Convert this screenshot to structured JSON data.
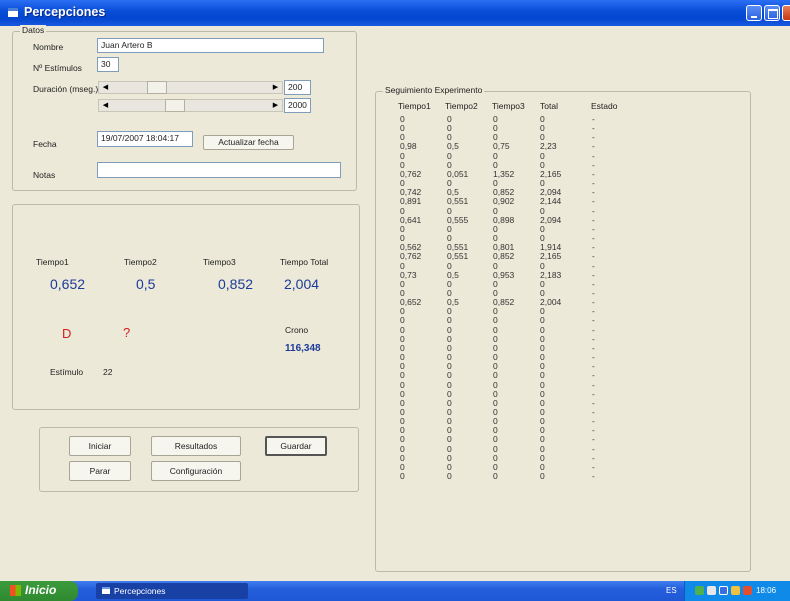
{
  "window": {
    "title": "Percepciones"
  },
  "datos": {
    "group_label": "Datos",
    "nombre_label": "Nombre",
    "nombre_value": "Juan Artero B",
    "estimulos_label": "Nº Estímulos",
    "estimulos_value": "30",
    "duracion_label": "Duración (mseg.)",
    "duracion1_value": "200",
    "duracion2_value": "2000",
    "fecha_label": "Fecha",
    "fecha_value": "19/07/2007 18:04:17",
    "actualizar_button": "Actualizar fecha",
    "notas_label": "Notas",
    "notas_value": ""
  },
  "results": {
    "tiempo1_label": "Tiempo1",
    "tiempo2_label": "Tiempo2",
    "tiempo3_label": "Tiempo3",
    "total_label": "Tiempo Total",
    "tiempo1_value": "0,652",
    "tiempo2_value": "0,5",
    "tiempo3_value": "0,852",
    "total_value": "2,004",
    "response1": "D",
    "response2": "?",
    "crono_label": "Crono",
    "crono_value": "116,348",
    "estimulo_label": "Estímulo",
    "estimulo_value": "22"
  },
  "buttons": {
    "iniciar": "Iniciar",
    "resultados": "Resultados",
    "guardar": "Guardar",
    "parar": "Parar",
    "configuracion": "Configuración"
  },
  "experiment": {
    "group_label": "Seguimiento Experimento",
    "headers": [
      "Tiempo1",
      "Tiempo2",
      "Tiempo3",
      "Total",
      "Estado"
    ],
    "rows": [
      [
        "0",
        "0",
        "0",
        "0",
        "-"
      ],
      [
        "0",
        "0",
        "0",
        "0",
        "-"
      ],
      [
        "0",
        "0",
        "0",
        "0",
        "-"
      ],
      [
        "0,98",
        "0,5",
        "0,75",
        "2,23",
        "-"
      ],
      [
        "0",
        "0",
        "0",
        "0",
        "-"
      ],
      [
        "0",
        "0",
        "0",
        "0",
        "-"
      ],
      [
        "0,762",
        "0,051",
        "1,352",
        "2,165",
        "-"
      ],
      [
        "0",
        "0",
        "0",
        "0",
        "-"
      ],
      [
        "0,742",
        "0,5",
        "0,852",
        "2,094",
        "-"
      ],
      [
        "0,891",
        "0,551",
        "0,902",
        "2,144",
        "-"
      ],
      [
        "0",
        "0",
        "0",
        "0",
        "-"
      ],
      [
        "0,641",
        "0,555",
        "0,898",
        "2,094",
        "-"
      ],
      [
        "0",
        "0",
        "0",
        "0",
        "-"
      ],
      [
        "0",
        "0",
        "0",
        "0",
        "-"
      ],
      [
        "0,562",
        "0,551",
        "0,801",
        "1,914",
        "-"
      ],
      [
        "0,762",
        "0,551",
        "0,852",
        "2,165",
        "-"
      ],
      [
        "0",
        "0",
        "0",
        "0",
        "-"
      ],
      [
        "0,73",
        "0,5",
        "0,953",
        "2,183",
        "-"
      ],
      [
        "0",
        "0",
        "0",
        "0",
        "-"
      ],
      [
        "0",
        "0",
        "0",
        "0",
        "-"
      ],
      [
        "0,652",
        "0,5",
        "0,852",
        "2,004",
        "-"
      ],
      [
        "0",
        "0",
        "0",
        "0",
        "-"
      ],
      [
        "0",
        "0",
        "0",
        "0",
        "-"
      ],
      [
        "0",
        "0",
        "0",
        "0",
        "-"
      ],
      [
        "0",
        "0",
        "0",
        "0",
        "-"
      ],
      [
        "0",
        "0",
        "0",
        "0",
        "-"
      ],
      [
        "0",
        "0",
        "0",
        "0",
        "-"
      ],
      [
        "0",
        "0",
        "0",
        "0",
        "-"
      ],
      [
        "0",
        "0",
        "0",
        "0",
        "-"
      ],
      [
        "0",
        "0",
        "0",
        "0",
        "-"
      ],
      [
        "0",
        "0",
        "0",
        "0",
        "-"
      ],
      [
        "0",
        "0",
        "0",
        "0",
        "-"
      ],
      [
        "0",
        "0",
        "0",
        "0",
        "-"
      ],
      [
        "0",
        "0",
        "0",
        "0",
        "-"
      ],
      [
        "0",
        "0",
        "0",
        "0",
        "-"
      ],
      [
        "0",
        "0",
        "0",
        "0",
        "-"
      ],
      [
        "0",
        "0",
        "0",
        "0",
        "-"
      ],
      [
        "0",
        "0",
        "0",
        "0",
        "-"
      ],
      [
        "0",
        "0",
        "0",
        "0",
        "-"
      ],
      [
        "0",
        "0",
        "0",
        "0",
        "-"
      ]
    ]
  },
  "taskbar": {
    "start_label": "Inicio",
    "task_label": "Percepciones",
    "language": "ES",
    "clock": "18:06"
  }
}
